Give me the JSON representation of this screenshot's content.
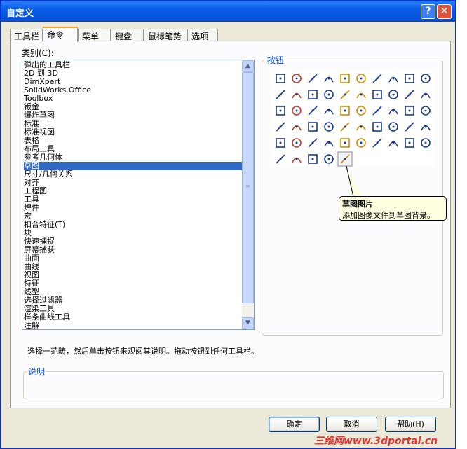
{
  "window": {
    "title": "自定义",
    "help_label": "?",
    "close_label": "✕"
  },
  "tabs": [
    {
      "label": "工具栏"
    },
    {
      "label": "命令"
    },
    {
      "label": "菜单"
    },
    {
      "label": "键盘"
    },
    {
      "label": "鼠标笔势"
    },
    {
      "label": "选项"
    }
  ],
  "category": {
    "label": "类别(C):",
    "items": [
      "弹出的工具栏",
      "2D 到 3D",
      "DimXpert",
      "SolidWorks Office",
      "Toolbox",
      "钣金",
      "爆炸草图",
      "标准",
      "标准视图",
      "表格",
      "布局工具",
      "参考几何体",
      "草图",
      "尺寸/几何关系",
      "对齐",
      "工程图",
      "工具",
      "焊件",
      "宏",
      "扣合特征(T)",
      "块",
      "快速捕捉",
      "屏幕捕获",
      "曲面",
      "曲线",
      "视图",
      "特征",
      "线型",
      "选择过滤器",
      "渲染工具",
      "样条曲线工具",
      "注解"
    ],
    "selected": "草图"
  },
  "buttons_group": {
    "label": "按钮",
    "icons": [
      "select-arrow-icon",
      "grid-icon",
      "sketch-edit-icon",
      "3d-sketch-icon",
      "sketch-plane-icon",
      "smart-sketch-icon",
      "line-icon",
      "rectangle-icon",
      "center-rectangle-icon",
      "diamond-icon",
      "corner-point-icon",
      "parallelogram-icon",
      "slot-icon",
      "center-slot-icon",
      "arc-slot-icon",
      "three-point-slot-icon",
      "circle-icon",
      "perimeter-circle-icon",
      "tangent-arc-icon",
      "three-point-arc-icon",
      "centerpoint-arc-icon",
      "partial-ellipse-icon",
      "ellipse-icon",
      "parabola-icon",
      "spline-icon",
      "spline-surface-icon",
      "point-icon",
      "centerline-icon",
      "asterisk-icon",
      "text-icon",
      "fillet-icon",
      "chamfer-icon",
      "offset-icon",
      "trim-icon",
      "extend-icon",
      "split-icon",
      "convert-entities-icon",
      "intersection-curve-icon",
      "face-curves-icon",
      "mirror-icon",
      "dynamic-mirror-icon",
      "move-icon",
      "rotate-icon",
      "scale-icon",
      "copy-icon",
      "stretch-icon",
      "linear-pattern-icon",
      "circular-pattern-icon",
      "block-icon",
      "grid-pattern-icon",
      "point-cloud-icon",
      "loop-icon",
      "modify-icon",
      "relations-icon",
      "sketch-picture-icon"
    ]
  },
  "tooltip": {
    "title": "草图图片",
    "text": "添加图像文件到草图背景。"
  },
  "hint": "选择一范畴，然后单击按钮来观阅其说明。拖动按钮到任何工具栏。",
  "description": {
    "label": "说明"
  },
  "footer": {
    "ok_label": "确定",
    "cancel_label": "取消",
    "help_label": "帮助(H)"
  },
  "watermark": "三维网www.3dportal.cn",
  "colors": {
    "titlebar": "#0a5ee8",
    "selection": "#316ac5",
    "group_label": "#0046d5",
    "tooltip_bg": "#ffffe1"
  }
}
